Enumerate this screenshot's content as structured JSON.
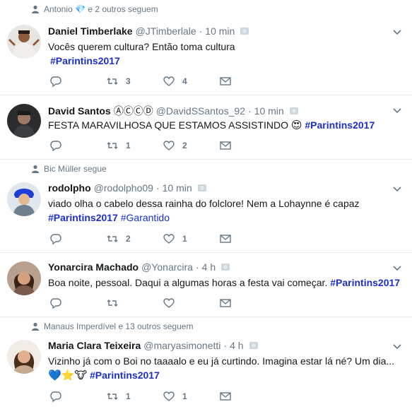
{
  "tweets": [
    {
      "social_context": "Antonio 💎 e 2 outros seguem",
      "name": "Daniel Timberlake",
      "badges": "",
      "handle": "@JTimberlale",
      "dot": "·",
      "time": "10 min",
      "text_line1": "Vocês querem cultura? Então toma cultura",
      "text_line2_prefix": "",
      "hashtag1": "#Parintins2017",
      "hashtag2": "",
      "retweets": "3",
      "likes": "4"
    },
    {
      "social_context": "",
      "name": "David Santos",
      "badges": "ⒶⒸⒸⒹ",
      "handle": "@DavidSSantos_92",
      "dot": "·",
      "time": "10 min",
      "text_line1": "FESTA MARAVILHOSA QUE ESTAMOS ASSISTINDO",
      "emoji": "😍",
      "hashtag1": "#Parintins2017",
      "retweets": "1",
      "likes": "2"
    },
    {
      "social_context": "Bic Müller segue",
      "name": "rodolpho",
      "badges": "",
      "handle": "@rodolpho09",
      "dot": "·",
      "time": "10 min",
      "text_line1": "viado olha o cabelo dessa rainha do folclore! Nem a Lohaynne é capaz",
      "hashtag1": "#Parintins2017",
      "hashtag2": "#Garantido",
      "retweets": "2",
      "likes": "1"
    },
    {
      "social_context": "",
      "name": "Yonarcira Machado",
      "handle": "@Yonarcira",
      "dot": "·",
      "time": "4 h",
      "text_line1": "Boa noite, pessoal. Daqui a algumas horas a festa vai começar.",
      "hashtag1": "#Parintins2017",
      "retweets": "",
      "likes": ""
    },
    {
      "social_context": "Manaus Imperdível e 13 outros seguem",
      "name": "Maria Clara Teixeira",
      "handle": "@maryasimonetti",
      "dot": "·",
      "time": "4 h",
      "text_line1": "Vizinho já com o Boi no taaaalo e eu já curtindo. Imagina estar lá né? Um dia...",
      "emojis": "💙⭐🐮",
      "hashtag1": "#Parintins2017",
      "retweets": "1",
      "likes": "1"
    }
  ],
  "colors": {
    "hashtag": "#1b2fc9",
    "secondary": "#657786",
    "divider": "#e6ecf0"
  },
  "icons": {
    "reply": "reply-icon",
    "retweet": "retweet-icon",
    "like": "heart-icon",
    "dm": "envelope-icon",
    "caret": "chevron-down-icon",
    "social": "person-icon"
  }
}
